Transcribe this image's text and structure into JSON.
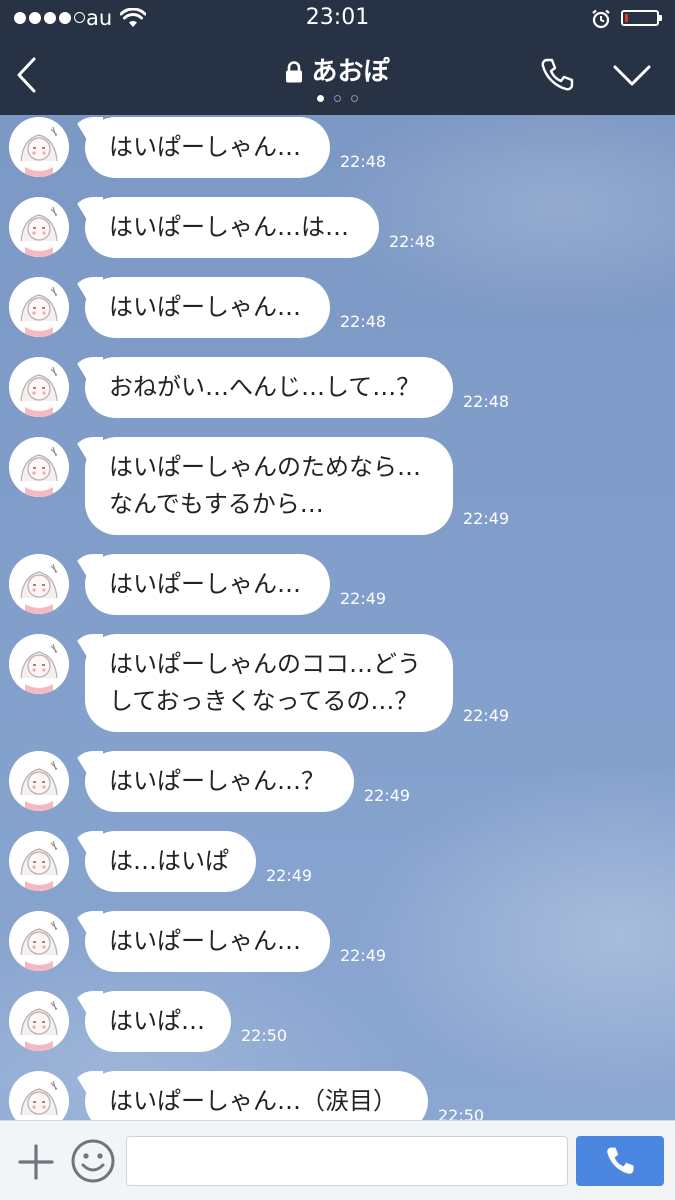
{
  "status_bar": {
    "carrier": "au",
    "time": "23:01",
    "icons": [
      "signal-icon",
      "wifi-icon",
      "alarm-icon",
      "battery-icon"
    ]
  },
  "header": {
    "title": "あおぽ",
    "icons": [
      "back-icon",
      "lock-icon",
      "call-icon",
      "chevron-down-icon"
    ],
    "page_indicator": {
      "count": 3,
      "active": 0
    }
  },
  "messages": [
    {
      "lines": [
        "はいぱーしゃん…"
      ],
      "time": "22:48"
    },
    {
      "lines": [
        "はいぱーしゃん…は…"
      ],
      "time": "22:48"
    },
    {
      "lines": [
        "はいぱーしゃん…"
      ],
      "time": "22:48"
    },
    {
      "lines": [
        "おねがい…へんじ…して…？"
      ],
      "time": "22:48"
    },
    {
      "lines": [
        "はいぱーしゃんのためなら…",
        "なんでもするから…"
      ],
      "time": "22:49"
    },
    {
      "lines": [
        "はいぱーしゃん…"
      ],
      "time": "22:49"
    },
    {
      "lines": [
        "はいぱーしゃんのココ…どう",
        "しておっきくなってるの…？"
      ],
      "time": "22:49"
    },
    {
      "lines": [
        "はいぱーしゃん…？"
      ],
      "time": "22:49"
    },
    {
      "lines": [
        "は…はいぱ"
      ],
      "time": "22:49"
    },
    {
      "lines": [
        "はいぱーしゃん…"
      ],
      "time": "22:49"
    },
    {
      "lines": [
        "はいぱ…"
      ],
      "time": "22:50"
    },
    {
      "lines": [
        "はいぱーしゃん…（涙目）"
      ],
      "time": "22:50"
    }
  ],
  "input_bar": {
    "value": "",
    "icons": [
      "plus-icon",
      "smile-icon",
      "call-icon"
    ]
  },
  "colors": {
    "header_bg": "#283245",
    "chat_bg": "#7f9bc7",
    "bubble": "#ffffff",
    "call_button": "#4b86e0"
  }
}
